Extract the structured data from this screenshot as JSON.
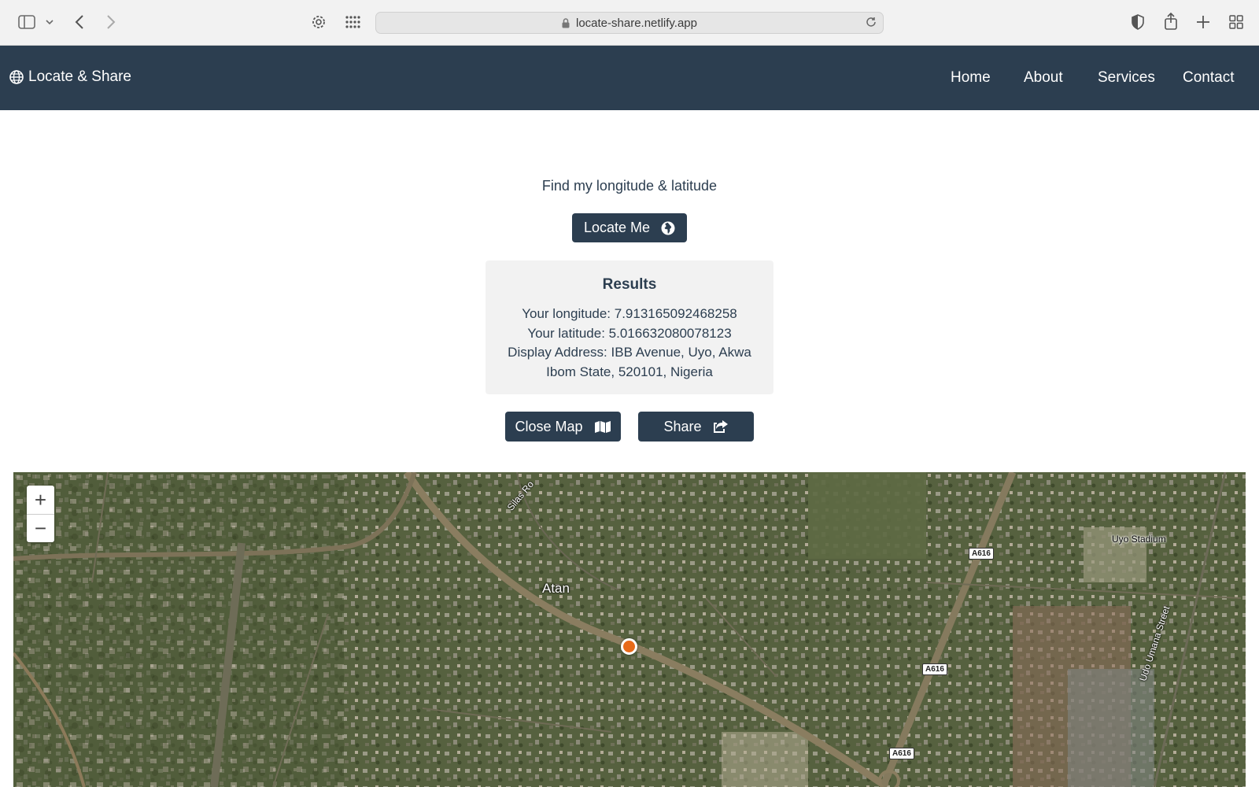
{
  "browser": {
    "url": "locate-share.netlify.app",
    "icons": [
      "sidebar-icon",
      "chevron-down-icon",
      "back-icon",
      "forward-icon",
      "settings-icon",
      "grid-icon",
      "lock-icon",
      "reload-icon",
      "shield-icon",
      "share-icon",
      "plus-icon",
      "tabs-overview-icon"
    ]
  },
  "nav": {
    "brand": "Locate & Share",
    "links": [
      "Home",
      "About",
      "Services",
      "Contact"
    ]
  },
  "main": {
    "intro": "Find my longitude & latitude",
    "locate_label": "Locate Me",
    "results": {
      "title": "Results",
      "longitude": "Your longitude: 7.913165092468258",
      "latitude": "Your latitude: 5.016632080078123",
      "address_line1": "Display Address: IBB Avenue, Uyo, Akwa",
      "address_line2": "Ibom State, 520101, Nigeria"
    },
    "close_map_label": "Close Map",
    "share_label": "Share"
  },
  "map": {
    "zoom_in": "+",
    "zoom_out": "−",
    "labels": {
      "atan": "Atan",
      "stadium": "Uyo Stadium",
      "silas": "Silas Ro",
      "udo": "Udo Umana Street",
      "road_a": "A616",
      "road_b": "A616",
      "road_c": "A616"
    }
  },
  "colors": {
    "primary": "#2c3e50",
    "results_bg": "#f2f2f2",
    "marker": "#e86a1a"
  }
}
